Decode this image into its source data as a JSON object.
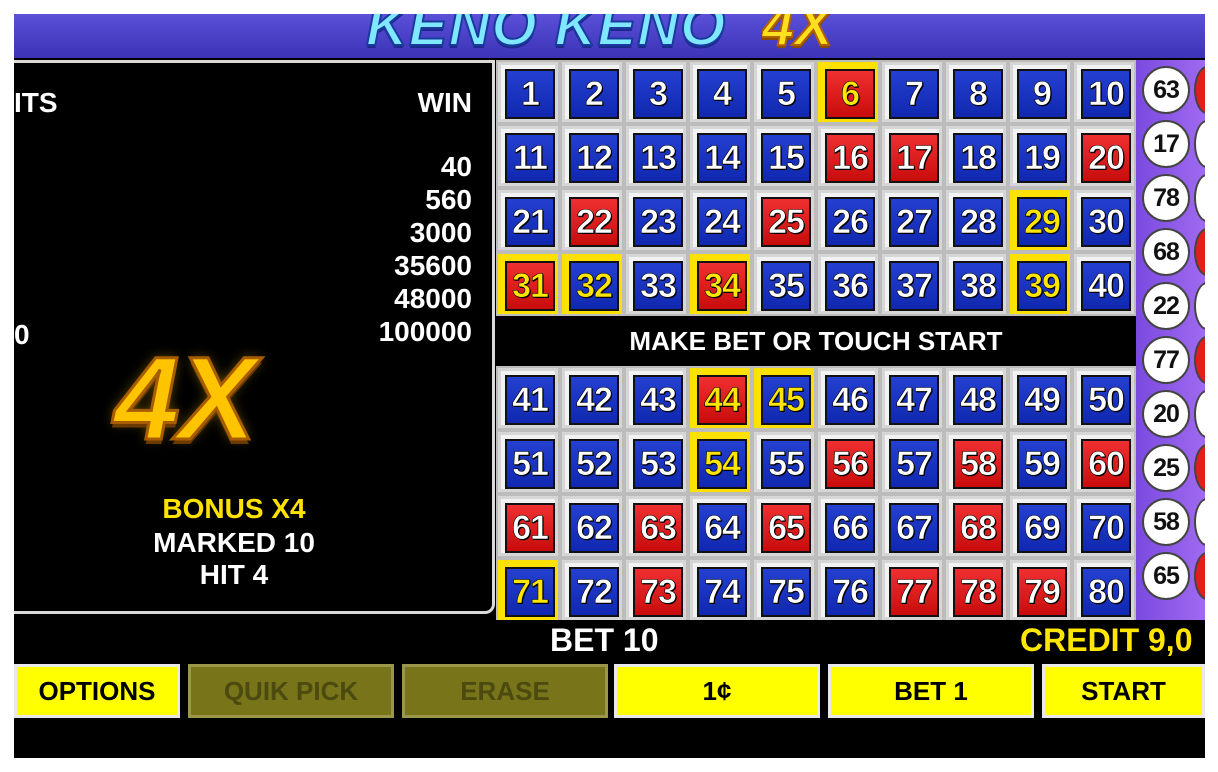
{
  "header": {
    "title_keno": "KENO KENO",
    "title_4x": "4X"
  },
  "paytable": {
    "head_hits": "ITS",
    "head_win": "WIN",
    "wins": [
      "40",
      "560",
      "3000",
      "35600",
      "48000",
      "100000"
    ],
    "partial_hit_value": "0"
  },
  "bonus_panel": {
    "multiplier": "4X",
    "bonus": "BONUS X4",
    "marked": "MARKED 10",
    "hit": "HIT 4"
  },
  "grid": {
    "message": "MAKE BET OR TOUCH START",
    "red_numbers": [
      6,
      16,
      17,
      20,
      22,
      25,
      31,
      34,
      44,
      56,
      58,
      60,
      61,
      63,
      65,
      68,
      73,
      77,
      78,
      79
    ],
    "hit_numbers": [
      6,
      29,
      31,
      32,
      34,
      39,
      44,
      45,
      54,
      71
    ]
  },
  "drawn_balls": [
    "63",
    "17",
    "78",
    "68",
    "22",
    "77",
    "20",
    "25",
    "58",
    "65"
  ],
  "status": {
    "bet": "BET 10",
    "credit": "CREDIT 9,0"
  },
  "buttons": {
    "options": "OPTIONS",
    "quik_pick": "QUIK PICK",
    "erase": "ERASE",
    "denomination": "1¢",
    "bet_one": "BET 1",
    "start": "START"
  },
  "colors": {
    "tile_blue": "#1a34c0",
    "tile_red": "#e01e1e",
    "hit_yellow": "#ffe000",
    "button_yellow": "#ffff00"
  }
}
